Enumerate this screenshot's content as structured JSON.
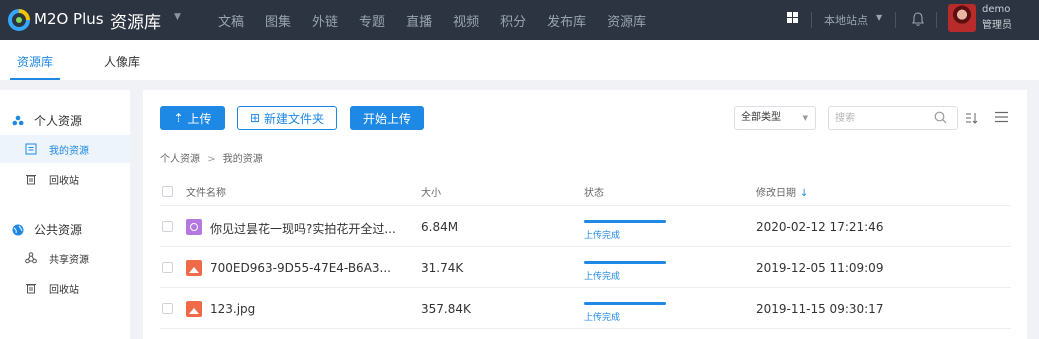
{
  "topbar": {
    "brand": "M2O Plus",
    "module": "资源库",
    "nav": [
      "文稿",
      "图集",
      "外链",
      "专题",
      "直播",
      "视频",
      "积分",
      "发布库",
      "资源库"
    ],
    "site": "本地站点",
    "user_name": "demo",
    "user_role": "管理员"
  },
  "tabs": [
    "资源库",
    "人像库"
  ],
  "sidebar": {
    "personal": {
      "title": "个人资源",
      "items": [
        "我的资源",
        "回收站"
      ]
    },
    "public": {
      "title": "公共资源",
      "items": [
        "共享资源",
        "回收站"
      ]
    }
  },
  "toolbar": {
    "upload": "上传",
    "new_folder": "新建文件夹",
    "start_upload": "开始上传",
    "type_select": "全部类型",
    "search_placeholder": "搜索"
  },
  "breadcrumb": [
    "个人资源",
    "我的资源"
  ],
  "breadcrumb_sep": ">",
  "table": {
    "columns": [
      "文件名称",
      "大小",
      "状态",
      "修改日期"
    ],
    "sort_arrow": "↓",
    "rows": [
      {
        "icon": "video-file-icon",
        "name": "你见过昙花一现吗?实拍花开全过...",
        "size": "6.84M",
        "progress": 1.0,
        "status": "上传完成",
        "date": "2020-02-12 17:21:46"
      },
      {
        "icon": "image-file-icon",
        "name": "700ED963-9D55-47E4-B6A3...",
        "size": "31.74K",
        "progress": 1.0,
        "status": "上传完成",
        "date": "2019-12-05 11:09:09"
      },
      {
        "icon": "image-file-icon",
        "name": "123.jpg",
        "size": "357.84K",
        "progress": 1.0,
        "status": "上传完成",
        "date": "2019-11-15 09:30:17"
      }
    ]
  },
  "colors": {
    "accent": "#1e88e5",
    "topbar": "#2b3440",
    "video_icon": "#b478e0",
    "image_icon": "#f06a4a"
  }
}
